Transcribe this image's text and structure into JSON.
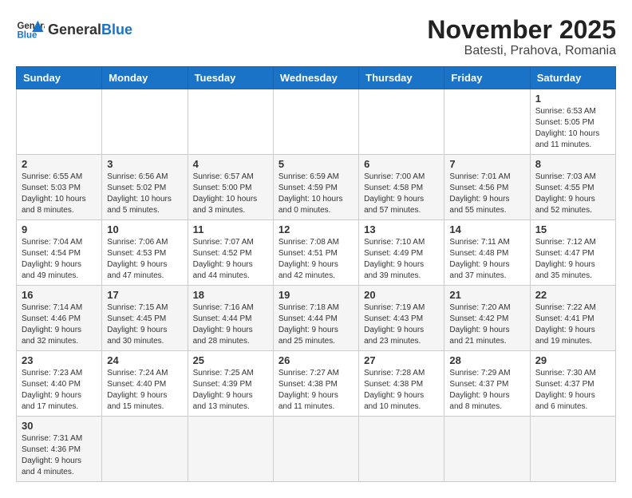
{
  "header": {
    "logo_general": "General",
    "logo_blue": "Blue",
    "month_title": "November 2025",
    "location": "Batesti, Prahova, Romania"
  },
  "days_of_week": [
    "Sunday",
    "Monday",
    "Tuesday",
    "Wednesday",
    "Thursday",
    "Friday",
    "Saturday"
  ],
  "weeks": [
    {
      "days": [
        {
          "num": "",
          "info": ""
        },
        {
          "num": "",
          "info": ""
        },
        {
          "num": "",
          "info": ""
        },
        {
          "num": "",
          "info": ""
        },
        {
          "num": "",
          "info": ""
        },
        {
          "num": "",
          "info": ""
        },
        {
          "num": "1",
          "info": "Sunrise: 6:53 AM\nSunset: 5:05 PM\nDaylight: 10 hours and 11 minutes."
        }
      ]
    },
    {
      "days": [
        {
          "num": "2",
          "info": "Sunrise: 6:55 AM\nSunset: 5:03 PM\nDaylight: 10 hours and 8 minutes."
        },
        {
          "num": "3",
          "info": "Sunrise: 6:56 AM\nSunset: 5:02 PM\nDaylight: 10 hours and 5 minutes."
        },
        {
          "num": "4",
          "info": "Sunrise: 6:57 AM\nSunset: 5:00 PM\nDaylight: 10 hours and 3 minutes."
        },
        {
          "num": "5",
          "info": "Sunrise: 6:59 AM\nSunset: 4:59 PM\nDaylight: 10 hours and 0 minutes."
        },
        {
          "num": "6",
          "info": "Sunrise: 7:00 AM\nSunset: 4:58 PM\nDaylight: 9 hours and 57 minutes."
        },
        {
          "num": "7",
          "info": "Sunrise: 7:01 AM\nSunset: 4:56 PM\nDaylight: 9 hours and 55 minutes."
        },
        {
          "num": "8",
          "info": "Sunrise: 7:03 AM\nSunset: 4:55 PM\nDaylight: 9 hours and 52 minutes."
        }
      ]
    },
    {
      "days": [
        {
          "num": "9",
          "info": "Sunrise: 7:04 AM\nSunset: 4:54 PM\nDaylight: 9 hours and 49 minutes."
        },
        {
          "num": "10",
          "info": "Sunrise: 7:06 AM\nSunset: 4:53 PM\nDaylight: 9 hours and 47 minutes."
        },
        {
          "num": "11",
          "info": "Sunrise: 7:07 AM\nSunset: 4:52 PM\nDaylight: 9 hours and 44 minutes."
        },
        {
          "num": "12",
          "info": "Sunrise: 7:08 AM\nSunset: 4:51 PM\nDaylight: 9 hours and 42 minutes."
        },
        {
          "num": "13",
          "info": "Sunrise: 7:10 AM\nSunset: 4:49 PM\nDaylight: 9 hours and 39 minutes."
        },
        {
          "num": "14",
          "info": "Sunrise: 7:11 AM\nSunset: 4:48 PM\nDaylight: 9 hours and 37 minutes."
        },
        {
          "num": "15",
          "info": "Sunrise: 7:12 AM\nSunset: 4:47 PM\nDaylight: 9 hours and 35 minutes."
        }
      ]
    },
    {
      "days": [
        {
          "num": "16",
          "info": "Sunrise: 7:14 AM\nSunset: 4:46 PM\nDaylight: 9 hours and 32 minutes."
        },
        {
          "num": "17",
          "info": "Sunrise: 7:15 AM\nSunset: 4:45 PM\nDaylight: 9 hours and 30 minutes."
        },
        {
          "num": "18",
          "info": "Sunrise: 7:16 AM\nSunset: 4:44 PM\nDaylight: 9 hours and 28 minutes."
        },
        {
          "num": "19",
          "info": "Sunrise: 7:18 AM\nSunset: 4:44 PM\nDaylight: 9 hours and 25 minutes."
        },
        {
          "num": "20",
          "info": "Sunrise: 7:19 AM\nSunset: 4:43 PM\nDaylight: 9 hours and 23 minutes."
        },
        {
          "num": "21",
          "info": "Sunrise: 7:20 AM\nSunset: 4:42 PM\nDaylight: 9 hours and 21 minutes."
        },
        {
          "num": "22",
          "info": "Sunrise: 7:22 AM\nSunset: 4:41 PM\nDaylight: 9 hours and 19 minutes."
        }
      ]
    },
    {
      "days": [
        {
          "num": "23",
          "info": "Sunrise: 7:23 AM\nSunset: 4:40 PM\nDaylight: 9 hours and 17 minutes."
        },
        {
          "num": "24",
          "info": "Sunrise: 7:24 AM\nSunset: 4:40 PM\nDaylight: 9 hours and 15 minutes."
        },
        {
          "num": "25",
          "info": "Sunrise: 7:25 AM\nSunset: 4:39 PM\nDaylight: 9 hours and 13 minutes."
        },
        {
          "num": "26",
          "info": "Sunrise: 7:27 AM\nSunset: 4:38 PM\nDaylight: 9 hours and 11 minutes."
        },
        {
          "num": "27",
          "info": "Sunrise: 7:28 AM\nSunset: 4:38 PM\nDaylight: 9 hours and 10 minutes."
        },
        {
          "num": "28",
          "info": "Sunrise: 7:29 AM\nSunset: 4:37 PM\nDaylight: 9 hours and 8 minutes."
        },
        {
          "num": "29",
          "info": "Sunrise: 7:30 AM\nSunset: 4:37 PM\nDaylight: 9 hours and 6 minutes."
        }
      ]
    },
    {
      "days": [
        {
          "num": "30",
          "info": "Sunrise: 7:31 AM\nSunset: 4:36 PM\nDaylight: 9 hours and 4 minutes."
        },
        {
          "num": "",
          "info": ""
        },
        {
          "num": "",
          "info": ""
        },
        {
          "num": "",
          "info": ""
        },
        {
          "num": "",
          "info": ""
        },
        {
          "num": "",
          "info": ""
        },
        {
          "num": "",
          "info": ""
        }
      ]
    }
  ]
}
